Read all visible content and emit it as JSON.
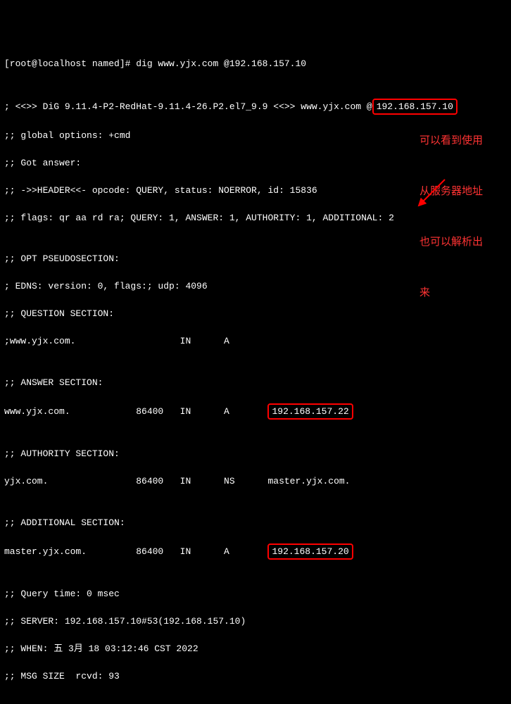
{
  "prompt": "[root@localhost named]# dig www.yjx.com @192.168.157.10",
  "blank1": "",
  "dig_header_pre": "; <<>> DiG 9.11.4-P2-RedHat-9.11.4-26.P2.el7_9.9 <<>> www.yjx.com @",
  "dig_server": "192.168.157.10",
  "global_opts": ";; global options: +cmd",
  "got_answer": ";; Got answer:",
  "header": ";; ->>HEADER<<- opcode: QUERY, status: NOERROR, id: 15836",
  "flags": ";; flags: qr aa rd ra; QUERY: 1, ANSWER: 1, AUTHORITY: 1, ADDITIONAL: 2",
  "opt_hdr": ";; OPT PSEUDOSECTION:",
  "edns": "; EDNS: version: 0, flags:; udp: 4096",
  "question_hdr": ";; QUESTION SECTION:",
  "question_row": ";www.yjx.com.                   IN      A",
  "answer_hdr": ";; ANSWER SECTION:",
  "answer_row_pre": "www.yjx.com.            86400   IN      A       ",
  "answer_ip": "192.168.157.22",
  "authority_hdr": ";; AUTHORITY SECTION:",
  "authority_row": "yjx.com.                86400   IN      NS      master.yjx.com.",
  "additional_hdr": ";; ADDITIONAL SECTION:",
  "additional_row_pre": "master.yjx.com.         86400   IN      A       ",
  "additional_ip": "192.168.157.20",
  "query_time": ";; Query time: 0 msec",
  "server_line": ";; SERVER: 192.168.157.10#53(192.168.157.10)",
  "when_line": ";; WHEN: 五 3月 18 03:12:46 CST 2022",
  "msg_size": ";; MSG SIZE  rcvd: 93",
  "annotation": {
    "l1": "可以看到使用",
    "l2": "从服务器地址",
    "l3": "也可以解析出",
    "l4": "来"
  }
}
